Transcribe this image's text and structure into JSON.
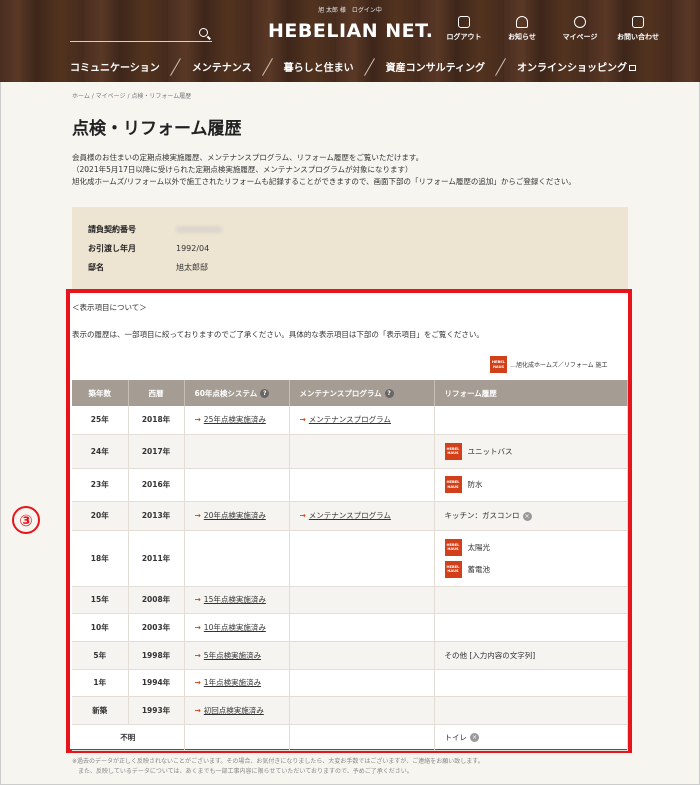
{
  "header": {
    "user_status": "旭 太郎 様　ログイン中",
    "logo": "HEBELIAN NET.",
    "search_placeholder": "",
    "icons": [
      {
        "label": "ログアウト",
        "icon": "logout-icon"
      },
      {
        "label": "お知らせ",
        "icon": "bell-icon"
      },
      {
        "label": "マイページ",
        "icon": "user-icon"
      },
      {
        "label": "お問い合わせ",
        "icon": "mail-icon"
      }
    ],
    "nav": [
      "コミュニケーション",
      "メンテナンス",
      "暮らしと住まい",
      "資産コンサルティング",
      "オンラインショッピング"
    ]
  },
  "breadcrumb": "ホーム / マイページ / 点検・リフォーム履歴",
  "page_title": "点検・リフォーム履歴",
  "intro": [
    "会員様のお住まいの定期点検実施履歴、メンテナンスプログラム、リフォーム履歴をご覧いただけます。",
    "（2021年5月17日以降に受けられた定期点検実施履歴、メンテナンスプログラムが対象になります）",
    "旭化成ホームズ/リフォーム以外で施工されたリフォームも記録することができますので、画面下部の「リフォーム履歴の追加」からご登録ください。"
  ],
  "info": {
    "contract_label": "請負契約番号",
    "movein_label": "お引渡し年月",
    "movein_value": "1992/04",
    "name_label": "邸名",
    "name_value": "旭太郎邸"
  },
  "marker": "③",
  "about_title": "＜表示項目について＞",
  "about_text": "表示の履歴は、一部項目に絞っておりますのでご了承ください。具体的な表示項目は下部の「表示項目」をご覧ください。",
  "legend": "…旭化成ホームズ／リフォーム 施工",
  "hh_badge": [
    "HEBEL",
    "HAUS"
  ],
  "table": {
    "headers": [
      "築年数",
      "西暦",
      "60年点検システム",
      "メンテナンスプログラム",
      "リフォーム履歴"
    ],
    "rows": [
      {
        "age": "25年",
        "year": "2018年",
        "inspection": "25年点検実施済み",
        "maintenance": "メンテナンスプログラム",
        "reform": ""
      },
      {
        "age": "24年",
        "year": "2017年",
        "inspection": "",
        "maintenance": "",
        "reform": "ユニットバス"
      },
      {
        "age": "23年",
        "year": "2016年",
        "inspection": "",
        "maintenance": "",
        "reform": "防水"
      },
      {
        "age": "20年",
        "year": "2013年",
        "inspection": "20年点検実施済み",
        "maintenance": "メンテナンスプログラム",
        "reform": "キッチン：ガスコンロ"
      },
      {
        "age": "18年",
        "year": "2011年",
        "inspection": "",
        "maintenance": "",
        "reform": "太陽光",
        "reform2": "蓄電池"
      },
      {
        "age": "15年",
        "year": "2008年",
        "inspection": "15年点検実施済み",
        "maintenance": "",
        "reform": ""
      },
      {
        "age": "10年",
        "year": "2003年",
        "inspection": "10年点検実施済み",
        "maintenance": "",
        "reform": ""
      },
      {
        "age": "5年",
        "year": "1998年",
        "inspection": "5年点検実施済み",
        "maintenance": "",
        "reform": "その他 [入力内容の文字列]"
      },
      {
        "age": "1年",
        "year": "1994年",
        "inspection": "1年点検実施済み",
        "maintenance": "",
        "reform": ""
      },
      {
        "age": "新築",
        "year": "1993年",
        "inspection": "初回点検実施済み",
        "maintenance": "",
        "reform": ""
      },
      {
        "age": "不明",
        "year": "",
        "inspection": "",
        "maintenance": "",
        "reform": "トイレ"
      }
    ]
  },
  "footnote": [
    "※過去のデータが正しく反映されないことがございます。その場合、お気付きになりましたら、大変お手数ではございますが、ご連絡をお願い致します。",
    "　また、反映しているデータについては、あくまでも一部工事内容に限らせていただいておりますので、予めご了承ください。"
  ],
  "colors": {
    "accent": "#e8141c",
    "hebel": "#d2401a",
    "table_header": "#a59d93",
    "info_bg": "#eee4d2"
  }
}
